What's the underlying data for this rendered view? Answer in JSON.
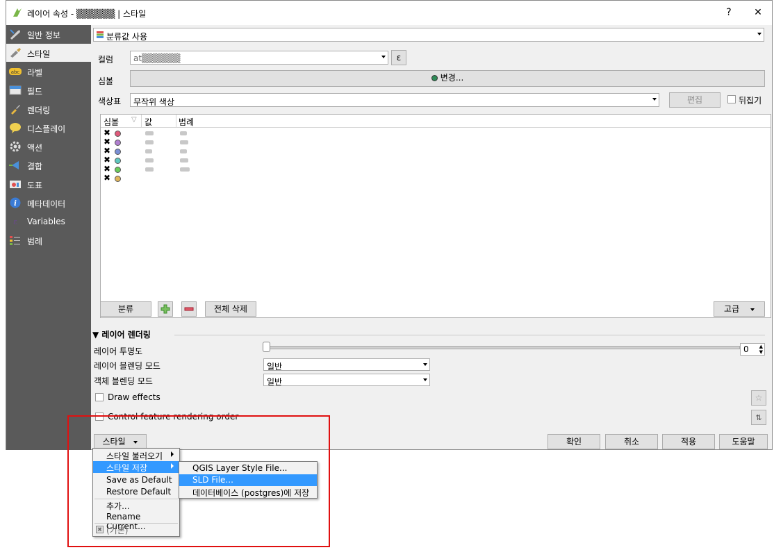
{
  "window": {
    "title": "레이어 속성 - ▒▒▒▒▒▒ | 스타일",
    "help_label": "?",
    "close_label": "✕"
  },
  "sidebar": {
    "items": [
      {
        "label": "일반 정보",
        "icon": "wrench-icon"
      },
      {
        "label": "스타일",
        "icon": "paintbrush-icon",
        "selected": true
      },
      {
        "label": "라벨",
        "icon": "abc-label-icon"
      },
      {
        "label": "필드",
        "icon": "table-icon"
      },
      {
        "label": "렌더링",
        "icon": "brush-icon"
      },
      {
        "label": "디스플레이",
        "icon": "speech-bubble-icon"
      },
      {
        "label": "액션",
        "icon": "gear-icon"
      },
      {
        "label": "결합",
        "icon": "join-icon"
      },
      {
        "label": "도표",
        "icon": "chart-icon"
      },
      {
        "label": "메타데이터",
        "icon": "info-icon"
      },
      {
        "label": "Variables",
        "icon": "variables-icon"
      },
      {
        "label": "범례",
        "icon": "legend-icon"
      }
    ]
  },
  "renderer": {
    "type_label": "분류값 사용",
    "column_label": "컬럼",
    "column_value": "at▒▒▒▒▒▒",
    "expression_label": "ε",
    "symbol_label": "심볼",
    "symbol_change_label": "변경...",
    "colorramp_label": "색상표",
    "colorramp_value": "무작위 색상",
    "edit_label": "편집",
    "invert_label": "뒤집기"
  },
  "table": {
    "headers": [
      "심볼",
      "값",
      "범례"
    ],
    "rows": [
      {
        "checked": "✖",
        "color": "#e05a7a"
      },
      {
        "checked": "✖",
        "color": "#b07fd0"
      },
      {
        "checked": "✖",
        "color": "#7a8fd6"
      },
      {
        "checked": "✖",
        "color": "#5ec8c0"
      },
      {
        "checked": "✖",
        "color": "#6acb5a"
      },
      {
        "checked": "✖",
        "color": "#e0b55a"
      }
    ]
  },
  "actions": {
    "classify_label": "분류",
    "delete_all_label": "전체 삭제",
    "advanced_label": "고급"
  },
  "layer_rendering": {
    "section_title": "레이어 렌더링",
    "opacity_label": "레이어 투명도",
    "opacity_value": "0",
    "blend_label": "레이어 블렌딩 모드",
    "blend_value": "일반",
    "feature_blend_label": "객체 블렌딩 모드",
    "feature_blend_value": "일반",
    "draw_effects_label": "Draw effects",
    "control_order_label": "Control feature rendering order"
  },
  "footer": {
    "style_label": "스타일",
    "ok_label": "확인",
    "cancel_label": "취소",
    "apply_label": "적용",
    "help_label": "도움말"
  },
  "style_menu": {
    "items": [
      "스타일 불러오기",
      "스타일 저장",
      "Save as Default",
      "Restore Default",
      "추가...",
      "Rename Current...",
      "(기본)"
    ]
  },
  "save_submenu": {
    "items": [
      "QGIS Layer Style File...",
      "SLD File...",
      "데이터베이스 (postgres)에 저장"
    ]
  },
  "colors": {
    "sidebar_bg": "#5a5a5a",
    "highlight": "#3399ff",
    "annotation": "#e01010"
  }
}
